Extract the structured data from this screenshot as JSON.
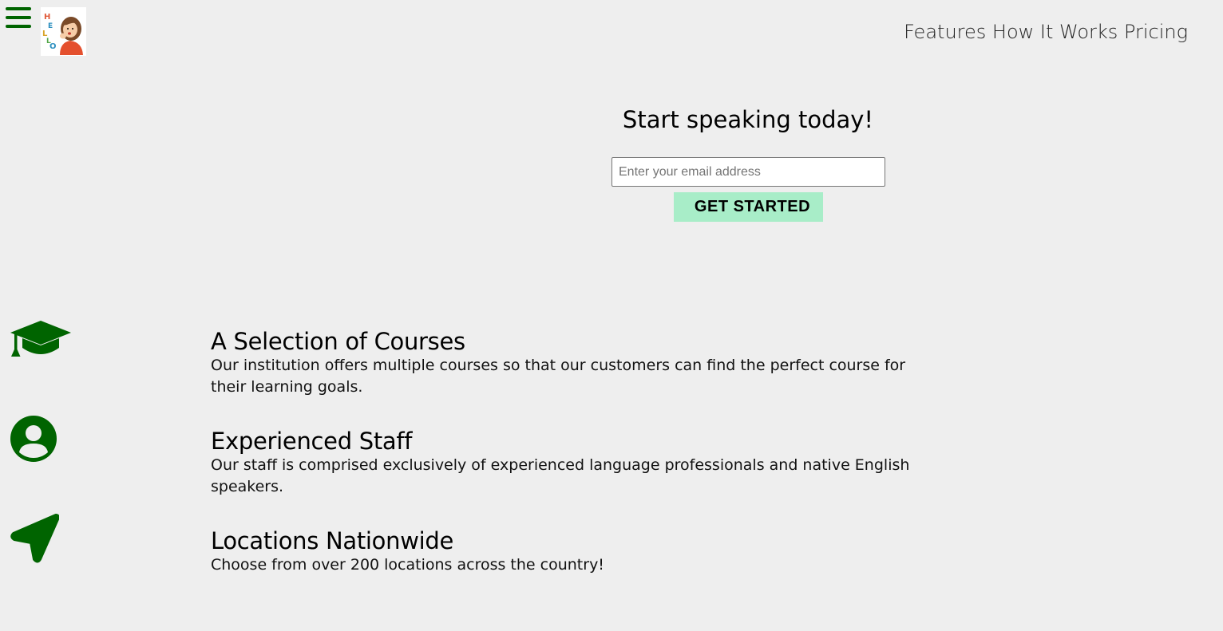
{
  "header": {
    "menu_icon": "hamburger-menu-icon",
    "logo_icon": "hello-girl-logo-icon",
    "nav": [
      {
        "label": "Features"
      },
      {
        "label": "How It Works"
      },
      {
        "label": "Pricing"
      }
    ]
  },
  "hero": {
    "title": "Start speaking today!",
    "email_placeholder": "Enter your email address",
    "email_value": "",
    "cta_label": "GET STARTED"
  },
  "features": [
    {
      "icon": "graduation-cap-icon",
      "title": "A Selection of Courses",
      "description": "Our institution offers multiple courses so that our customers can find the perfect course for their learning goals."
    },
    {
      "icon": "user-circle-icon",
      "title": "Experienced Staff",
      "description": "Our staff is comprised exclusively of experienced language professionals and native English speakers."
    },
    {
      "icon": "location-arrow-icon",
      "title": "Locations Nationwide",
      "description": "Choose from over 200 locations across the country!"
    }
  ],
  "colors": {
    "background": "#eeeeee",
    "icon_green": "#006400",
    "cta_background": "#a8edc8"
  }
}
